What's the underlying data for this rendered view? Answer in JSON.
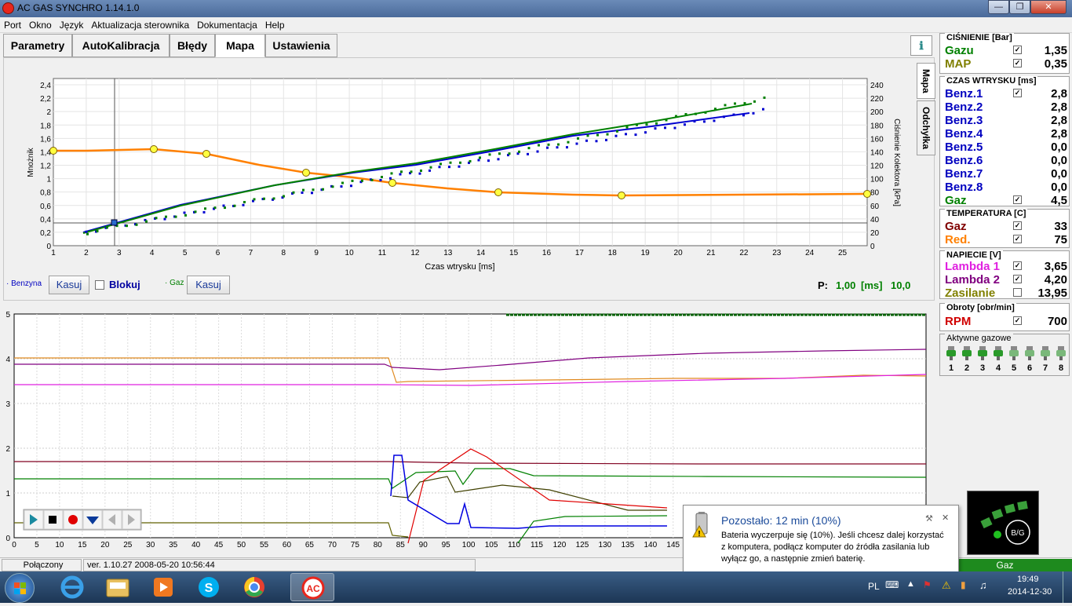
{
  "window": {
    "title": "AC GAS SYNCHRO    1.14.1.0"
  },
  "menu": [
    "Port",
    "Okno",
    "Język",
    "Aktualizacja sterownika",
    "Dokumentacja",
    "Help"
  ],
  "tabs": [
    "Parametry",
    "AutoKalibracja",
    "Błędy",
    "Mapa",
    "Ustawienia"
  ],
  "help_icon": "info-icon",
  "side_tabs": [
    "Mapa",
    "Odchyłka"
  ],
  "map_chart": {
    "ylabel_left": "Mnożnik",
    "ylabel_right": "Ciśnienie Kolektora [kPa]",
    "xlabel": "Czas wtrysku [ms]",
    "yticks_left": [
      "0",
      "0,2",
      "0,4",
      "0,6",
      "0,8",
      "1",
      "1,2",
      "1,4",
      "1,6",
      "1,8",
      "2",
      "2,2",
      "2,4"
    ],
    "yticks_right": [
      "0",
      "20",
      "40",
      "60",
      "80",
      "100",
      "120",
      "140",
      "160",
      "180",
      "200",
      "220",
      "240"
    ],
    "xticks": [
      "1",
      "2",
      "3",
      "4",
      "5",
      "6",
      "7",
      "8",
      "9",
      "10",
      "11",
      "12",
      "13",
      "14",
      "15",
      "16",
      "17",
      "18",
      "19",
      "20",
      "21",
      "22",
      "23",
      "24",
      "25"
    ]
  },
  "controls": {
    "benzyna_label": "· Benzyna",
    "kasuj1": "Kasuj",
    "blokuj": "Blokuj",
    "gaz_label": "· Gaz",
    "kasuj2": "Kasuj",
    "p_label": "P:",
    "p_value": "1,00",
    "p_unit": "[ms]",
    "p_value2": "10,0"
  },
  "bottom_chart": {
    "yticks": [
      "0",
      "1",
      "2",
      "3",
      "4",
      "5"
    ],
    "xticks": [
      "0",
      "5",
      "10",
      "15",
      "20",
      "25",
      "30",
      "35",
      "40",
      "45",
      "50",
      "55",
      "60",
      "65",
      "70",
      "75",
      "80",
      "85",
      "90",
      "95",
      "100",
      "105",
      "110",
      "115",
      "120",
      "125",
      "130",
      "135",
      "140",
      "145"
    ]
  },
  "status": {
    "connection": "Połączony",
    "version": "ver. 1.10.27   2008-05-20  10:56:44"
  },
  "right": {
    "pressure_title": "CIŚNIENIE [Bar]",
    "pressure": [
      {
        "label": "Gazu",
        "value": "1,35",
        "checked": true,
        "color": "#008000"
      },
      {
        "label": "MAP",
        "value": "0,35",
        "checked": true,
        "color": "#808000"
      }
    ],
    "inj_title": "CZAS WTRYSKU  [ms]",
    "inj": [
      {
        "label": "Benz.1",
        "value": "2,8",
        "checked": true,
        "color": "#0000c0"
      },
      {
        "label": "Benz.2",
        "value": "2,8",
        "checked": false,
        "color": "#0000c0"
      },
      {
        "label": "Benz.3",
        "value": "2,8",
        "checked": false,
        "color": "#0000c0"
      },
      {
        "label": "Benz.4",
        "value": "2,8",
        "checked": false,
        "color": "#0000c0"
      },
      {
        "label": "Benz.5",
        "value": "0,0",
        "checked": false,
        "color": "#0000c0"
      },
      {
        "label": "Benz.6",
        "value": "0,0",
        "checked": false,
        "color": "#0000c0"
      },
      {
        "label": "Benz.7",
        "value": "0,0",
        "checked": false,
        "color": "#0000c0"
      },
      {
        "label": "Benz.8",
        "value": "0,0",
        "checked": false,
        "color": "#0000c0"
      },
      {
        "label": "Gaz",
        "value": "4,5",
        "checked": true,
        "color": "#008000"
      }
    ],
    "temp_title": "TEMPERATURA  [C]",
    "temp": [
      {
        "label": "Gaz",
        "value": "33",
        "checked": true,
        "color": "#800000"
      },
      {
        "label": "Red.",
        "value": "75",
        "checked": true,
        "color": "#ff8000"
      }
    ],
    "volt_title": "NAPIECIE [V]",
    "volt": [
      {
        "label": "Lambda 1",
        "value": "3,65",
        "checked": true,
        "color": "#e020e0"
      },
      {
        "label": "Lambda 2",
        "value": "4,20",
        "checked": true,
        "color": "#800080"
      },
      {
        "label": "Zasilanie",
        "value": "13,95",
        "checked": false,
        "color": "#808000"
      }
    ],
    "rpm_title": "Obroty [obr/min]",
    "rpm": {
      "label": "RPM",
      "value": "700",
      "checked": true,
      "color": "#d00000"
    },
    "active_title": "Aktywne gazowe",
    "injectors": [
      "1",
      "2",
      "3",
      "4",
      "5",
      "6",
      "7",
      "8"
    ],
    "bg_label": "B/G",
    "gaz_status": "Gaz"
  },
  "notification": {
    "title": "Pozostało: 12 min (10%)",
    "body": "Bateria wyczerpuje się (10%). Jeśli chcesz dalej korzystać z komputera, podłącz komputer do źródła zasilania lub wyłącz go, a następnie zmień baterię."
  },
  "tray": {
    "lang": "PL",
    "time": "19:49",
    "date": "2014-12-30"
  }
}
